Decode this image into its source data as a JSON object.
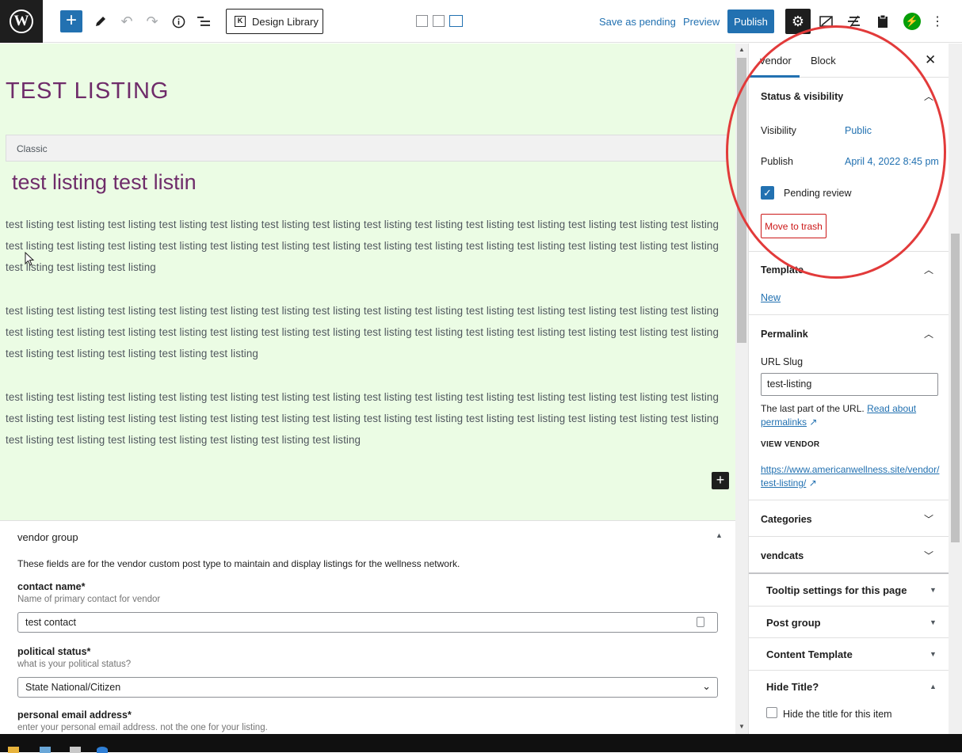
{
  "toolbar": {
    "design_library": "Design Library",
    "save_pending": "Save as pending",
    "preview": "Preview",
    "publish": "Publish"
  },
  "editor": {
    "title": "TEST LISTING",
    "classic_label": "Classic",
    "heading": "test listing test listin",
    "paragraphs": [
      "test listing test listing test listing test listing test listing test listing test listing test listing test listing test listing test listing test listing test listing test listing test listing test listing test listing test listing test listing test listing test listing test listing test listing test listing test listing test listing test listing test listing test listing test listing test listing",
      "test listing test listing test listing test listing test listing test listing test listing test listing test listing test listing test listing test listing test listing test listing test listing test listing test listing test listing test listing test listing test listing test listing test listing test listing test listing test listing test listing test listing test listing test listing test listing test listing test listing",
      "test listing test listing test listing test listing test listing test listing test listing test listing test listing test listing test listing test listing test listing test listing test listing test listing test listing test listing test listing test listing test listing test listing test listing test listing test listing test listing test listing test listing test listing test listing test listing test listing test listing test listing test listing"
    ]
  },
  "meta": {
    "group_title": "vendor group",
    "description": "These fields are for the vendor custom post type to maintain and display listings for the wellness network.",
    "fields": [
      {
        "label": "contact name*",
        "help": "Name of primary contact for vendor",
        "value": "test contact"
      },
      {
        "label": "political status*",
        "help": "what is your political status?",
        "value": "State National/Citizen"
      },
      {
        "label": "personal email address*",
        "help": "enter your personal email address. not the one for your listing."
      }
    ]
  },
  "sidebar": {
    "tabs": [
      "vendor",
      "Block"
    ],
    "status": {
      "title": "Status & visibility",
      "visibility_label": "Visibility",
      "visibility_value": "Public",
      "publish_label": "Publish",
      "publish_value": "April 4, 2022 8:45 pm",
      "pending_label": "Pending review",
      "pending_checked": true,
      "trash": "Move to trash"
    },
    "template": {
      "title": "Template",
      "value": "New"
    },
    "permalink": {
      "title": "Permalink",
      "slug_label": "URL Slug",
      "slug_value": "test-listing",
      "help_text": "The last part of the URL.",
      "help_link_a": "Read about",
      "help_link_b": "permalinks",
      "view_label": "VIEW VENDOR",
      "url_a": "https://www.americanwellness.site/vendor/",
      "url_b": "test-listing/"
    },
    "categories": "Categories",
    "vendcats": "vendcats",
    "boxes": [
      "Tooltip settings for this page",
      "Post group",
      "Content Template",
      "Hide Title?"
    ],
    "hide_title_label": "Hide the title for this item"
  },
  "colors": {
    "accent": "#2271b1",
    "editor_bg": "#ebfce4",
    "title_color": "#6f2c6a",
    "annotation": "#e23a3a",
    "trash": "#cc1818"
  }
}
